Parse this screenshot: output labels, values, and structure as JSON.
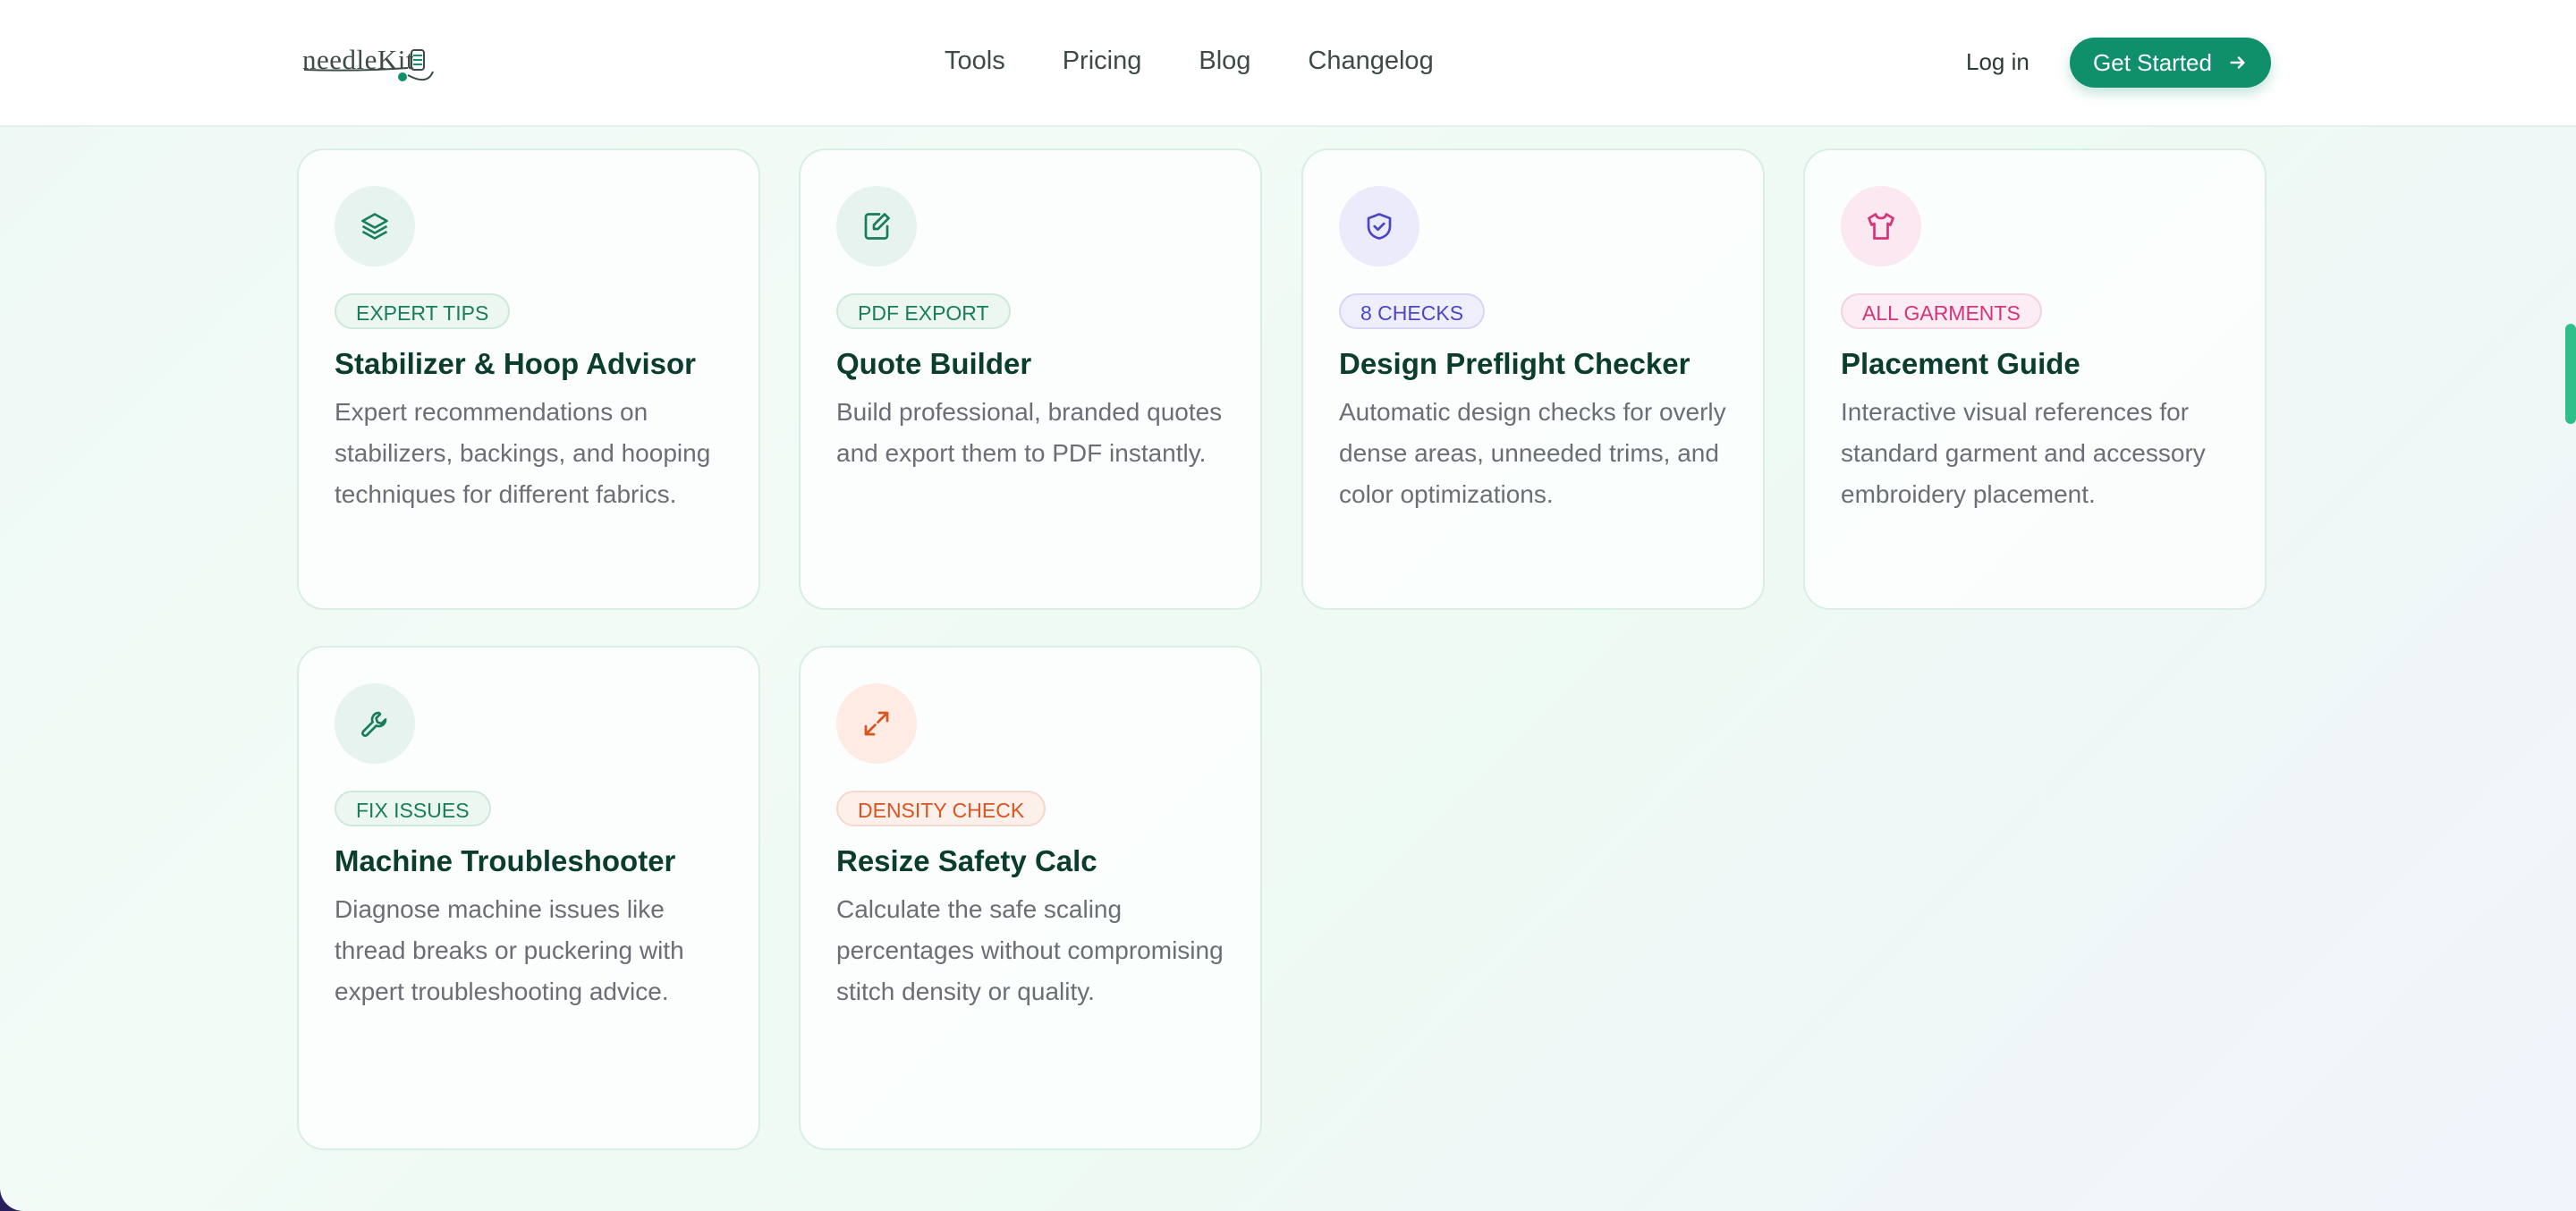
{
  "header": {
    "logo_text": "needleKit",
    "nav": [
      "Tools",
      "Pricing",
      "Blog",
      "Changelog"
    ],
    "login_label": "Log in",
    "cta_label": "Get Started"
  },
  "cards": [
    {
      "badge": "EXPERT TIPS",
      "title": "Stabilizer & Hoop Advisor",
      "desc": "Expert recommendations on stabilizers, backings, and hooping techniques for different fabrics.",
      "icon": "layers-icon",
      "accent": "#177d5b"
    },
    {
      "badge": "PDF EXPORT",
      "title": "Quote Builder",
      "desc": "Build professional, branded quotes and export them to PDF instantly.",
      "icon": "document-edit-icon",
      "accent": "#177d5b"
    },
    {
      "badge": "8 CHECKS",
      "title": "Design Preflight Checker",
      "desc": "Automatic design checks for overly dense areas, unneeded trims, and color optimizations.",
      "icon": "shield-check-icon",
      "accent": "#4b46c8"
    },
    {
      "badge": "ALL GARMENTS",
      "title": "Placement Guide",
      "desc": "Interactive visual references for standard garment and accessory embroidery placement.",
      "icon": "shirt-icon",
      "accent": "#d6337a"
    },
    {
      "badge": "FIX ISSUES",
      "title": "Machine Troubleshooter",
      "desc": "Diagnose machine issues like thread breaks or puckering with expert troubleshooting advice.",
      "icon": "wrench-icon",
      "accent": "#177d5b"
    },
    {
      "badge": "DENSITY CHECK",
      "title": "Resize Safety Calc",
      "desc": "Calculate the safe scaling percentages without compromising stitch density or quality.",
      "icon": "resize-icon",
      "accent": "#d9541e"
    }
  ]
}
